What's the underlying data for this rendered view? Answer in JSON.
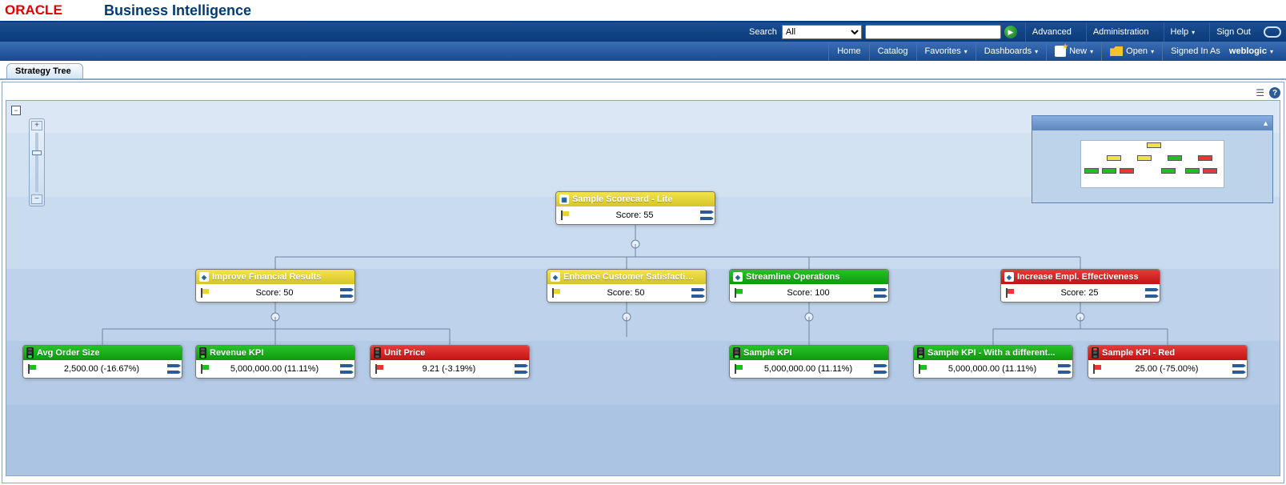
{
  "brand": {
    "logo_text": "ORACLE",
    "app_title": "Business Intelligence"
  },
  "global": {
    "search_label": "Search",
    "search_dropdown_value": "All",
    "search_field_value": "",
    "advanced": "Advanced",
    "administration": "Administration",
    "help": "Help",
    "signout": "Sign Out"
  },
  "nav": {
    "home": "Home",
    "catalog": "Catalog",
    "favorites": "Favorites",
    "dashboards": "Dashboards",
    "new": "New",
    "open": "Open",
    "signed_in_as_label": "Signed In As",
    "signed_in_user": "weblogic"
  },
  "tab": {
    "label": "Strategy Tree"
  },
  "collapse_glyph": "−",
  "zoom": {
    "plus": "+",
    "minus": "−"
  },
  "nodes": {
    "root": {
      "title": "Sample Scorecard - Lite",
      "value": "Score: 55"
    },
    "fin": {
      "title": "Improve Financial Results",
      "value": "Score: 50"
    },
    "cust": {
      "title": "Enhance Customer Satisfaction",
      "value": "Score: 50"
    },
    "ops": {
      "title": "Streamline Operations",
      "value": "Score: 100"
    },
    "emp": {
      "title": "Increase Empl. Effectiveness",
      "value": "Score: 25"
    },
    "kpi_avg": {
      "title": "Avg Order Size",
      "value": "2,500.00 (-16.67%)"
    },
    "kpi_rev": {
      "title": "Revenue KPI",
      "value": "5,000,000.00 (11.11%)"
    },
    "kpi_unit": {
      "title": "Unit Price",
      "value": "9.21 (-3.19%)"
    },
    "kpi_sample": {
      "title": "Sample KPI",
      "value": "5,000,000.00 (11.11%)"
    },
    "kpi_diff": {
      "title": "Sample KPI - With a different...",
      "value": "5,000,000.00 (11.11%)"
    },
    "kpi_red": {
      "title": "Sample KPI - Red",
      "value": "25.00 (-75.00%)"
    }
  },
  "minimap_collapse_glyph": "▲"
}
